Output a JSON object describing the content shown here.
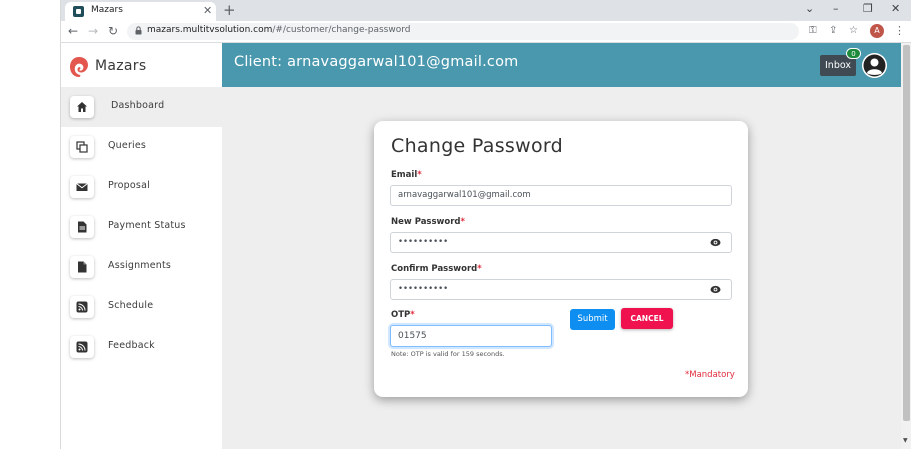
{
  "browser": {
    "tab_title": "Mazars",
    "tab_close": "✕",
    "new_tab": "+",
    "url_host": "mazars.multitvsolution.com",
    "url_path": "/#/customer/change-password",
    "profile_initial": "A"
  },
  "app": {
    "brand": "Mazars",
    "accent_color": "#4a98ae",
    "sidebar": {
      "items": [
        {
          "label": "Dashboard",
          "icon": "home-icon"
        },
        {
          "label": "Queries",
          "icon": "copy-icon"
        },
        {
          "label": "Proposal",
          "icon": "envelope-icon"
        },
        {
          "label": "Payment Status",
          "icon": "document-icon"
        },
        {
          "label": "Assignments",
          "icon": "file-icon"
        },
        {
          "label": "Schedule",
          "icon": "rss-icon"
        },
        {
          "label": "Feedback",
          "icon": "rss-icon"
        }
      ]
    },
    "header": {
      "client_text": "Client: arnavaggarwal101@gmail.com",
      "inbox_label": "Inbox",
      "inbox_count": "0"
    },
    "form": {
      "title": "Change Password",
      "email_label": "Email",
      "email_value": "arnavaggarwal101@gmail.com",
      "new_password_label": "New Password",
      "new_password_value": "••••••••••",
      "confirm_password_label": "Confirm Password",
      "confirm_password_value": "••••••••••",
      "otp_label": "OTP",
      "otp_value": "01575",
      "otp_note": "Note: OTP is valid for 159 seconds.",
      "submit_label": "Submit",
      "cancel_label": "CANCEL",
      "mandatory_note": "*Mandatory",
      "required_mark": "*"
    }
  }
}
